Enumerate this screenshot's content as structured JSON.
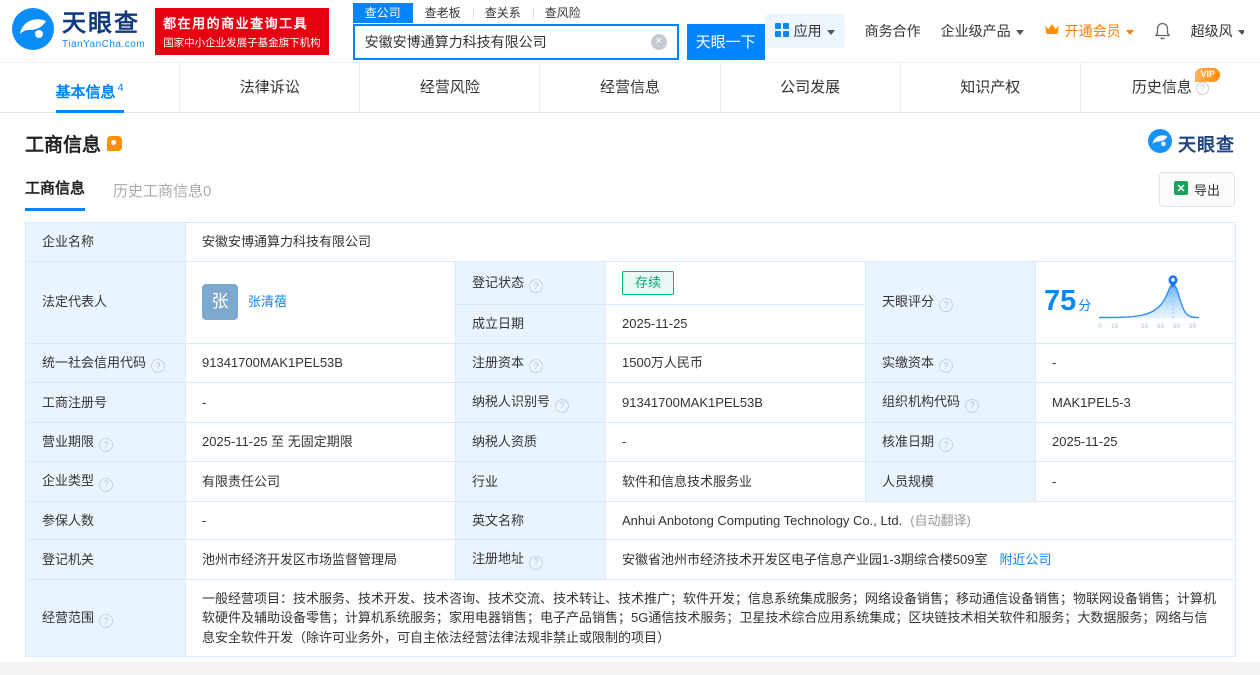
{
  "brand": {
    "name": "天眼查",
    "domain": "TianYanCha.com",
    "slogan_line1": "都在用的商业查询工具",
    "slogan_line2": "国家中小企业发展子基金旗下机构"
  },
  "search": {
    "tabs": [
      "查公司",
      "查老板",
      "查关系",
      "查风险"
    ],
    "value": "安徽安博通算力科技有限公司",
    "button_label": "天眼一下"
  },
  "header_menu": {
    "apps": "应用",
    "business": "商务合作",
    "enterprise_products": "企业级产品",
    "open_vip": "开通会员",
    "super_risk": "超级风"
  },
  "nav": {
    "tabs": [
      {
        "label": "基本信息",
        "badge": "4"
      },
      {
        "label": "法律诉讼"
      },
      {
        "label": "经营风险"
      },
      {
        "label": "经营信息"
      },
      {
        "label": "公司发展"
      },
      {
        "label": "知识产权"
      },
      {
        "label": "历史信息",
        "vip_tag": "VIP"
      }
    ]
  },
  "section": {
    "title": "工商信息",
    "watermark": "天眼查",
    "tabs": [
      "工商信息",
      "历史工商信息0"
    ],
    "export_label": "导出"
  },
  "fields": {
    "company_name_label": "企业名称",
    "company_name": "安徽安博通算力科技有限公司",
    "legal_rep_label": "法定代表人",
    "legal_rep_avatar": "张",
    "legal_rep_name": "张清蓓",
    "reg_status_label": "登记状态",
    "reg_status": "存续",
    "establish_date_label": "成立日期",
    "establish_date": "2025-11-25",
    "score_label": "天眼评分",
    "score": "75",
    "score_unit": "分",
    "credit_code_label": "统一社会信用代码",
    "credit_code": "91341700MAK1PEL53B",
    "reg_capital_label": "注册资本",
    "reg_capital": "1500万人民币",
    "paid_capital_label": "实缴资本",
    "paid_capital": "-",
    "reg_number_label": "工商注册号",
    "reg_number": "-",
    "taxpayer_id_label": "纳税人识别号",
    "taxpayer_id": "91341700MAK1PEL53B",
    "org_code_label": "组织机构代码",
    "org_code": "MAK1PEL5-3",
    "business_term_label": "营业期限",
    "business_term": "2025-11-25 至 无固定期限",
    "taxpayer_quality_label": "纳税人资质",
    "taxpayer_quality": "-",
    "approval_date_label": "核准日期",
    "approval_date": "2025-11-25",
    "company_type_label": "企业类型",
    "company_type": "有限责任公司",
    "industry_label": "行业",
    "industry": "软件和信息技术服务业",
    "staff_size_label": "人员规模",
    "staff_size": "-",
    "insured_count_label": "参保人数",
    "insured_count": "-",
    "english_name_label": "英文名称",
    "english_name": "Anhui Anbotong Computing Technology Co., Ltd.",
    "english_name_note": "(自动翻译)",
    "reg_authority_label": "登记机关",
    "reg_authority": "池州市经济开发区市场监督管理局",
    "address_label": "注册地址",
    "address": "安徽省池州市经济技术开发区电子信息产业园1-3期综合楼509室",
    "nearby_link": "附近公司",
    "business_scope_label": "经营范围",
    "business_scope": "一般经营项目：技术服务、技术开发、技术咨询、技术交流、技术转让、技术推广；软件开发；信息系统集成服务；网络设备销售；移动通信设备销售；物联网设备销售；计算机软硬件及辅助设备零售；计算机系统服务；家用电器销售；电子产品销售；5G通信技术服务；卫星技术综合应用系统集成；区块链技术相关软件和服务；大数据服务；网络与信息安全软件开发（除许可业务外，可自主依法经营法律法规非禁止或限制的项目）"
  },
  "score_chart": {
    "type": "area",
    "score": 75,
    "ticks": [
      "0",
      "15",
      "55",
      "65",
      "80",
      "95"
    ]
  },
  "icons": {
    "question": "?",
    "clear": "×"
  },
  "colors": {
    "primary_blue": "#0084ff",
    "brand_red": "#e60012",
    "status_green": "#00a87b",
    "vip_orange": "#ff7e00",
    "label_cell_bg": "#e9f5fe",
    "table_border": "#d8eafa"
  }
}
